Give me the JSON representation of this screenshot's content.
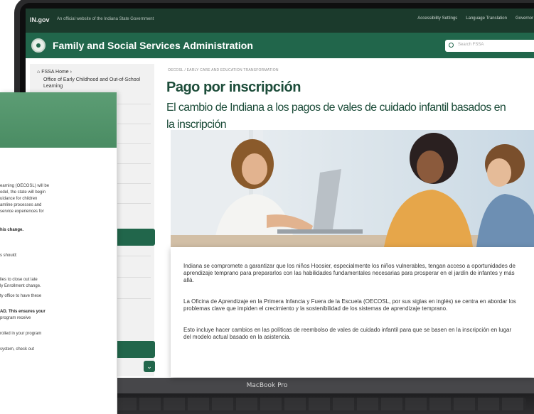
{
  "window": {
    "device_label": "MacBook Pro"
  },
  "top_bar": {
    "brand": "IN.gov",
    "official_text": "An official website of the Indiana State Government",
    "links": [
      "Accessibility Settings",
      "Language Translation",
      "Governor"
    ]
  },
  "header": {
    "site_title": "Family and Social Services Administration",
    "search_placeholder": "Search FSSA"
  },
  "sidebar": {
    "home_label": "FSSA Home",
    "section_label": "Office of Early Childhood and Out-of-School Learning"
  },
  "breadcrumb": "OECOSL / EARLY CARE AND EDUCATION TRANSFORMATION",
  "main": {
    "title": "Pago por inscripción",
    "subtitle": "El cambio de Indiana a los pagos de vales de cuidado infantil basados en la inscripción",
    "paragraphs": [
      "Indiana se compromete a garantizar que los niños Hoosier, especialmente los niños vulnerables, tengan acceso a oportunidades de aprendizaje temprano para prepararlos con las habilidades fundamentales necesarias para prosperar en el jardín de infantes y más allá.",
      "La Oficina de Aprendizaje en la Primera Infancia y Fuera de la Escuela (OECOSL, por sus siglas en inglés) se centra en abordar los problemas clave que impiden el crecimiento y la sostenibilidad de los sistemas de aprendizaje temprano.",
      "Esto incluye hacer cambios en las políticas de reembolso de vales de cuidado infantil para que se basen en la inscripción en lugar del modelo actual basado en la asistencia."
    ]
  },
  "back_panel": {
    "lines": [
      "earning (OECOSL) will be",
      "odel, the state will begin",
      "uidance for children",
      "amline processes and",
      "service experiences for",
      "his change.",
      "s should:",
      "lies to close out late",
      "ly Enrollment change.",
      "ty office to have these",
      "AD. This ensures your",
      "program receive",
      "rolled in your program",
      "system, check out"
    ]
  },
  "colors": {
    "brand_green": "#21664b",
    "dark_green": "#1b3a2c",
    "title_green": "#1d4d3a"
  }
}
